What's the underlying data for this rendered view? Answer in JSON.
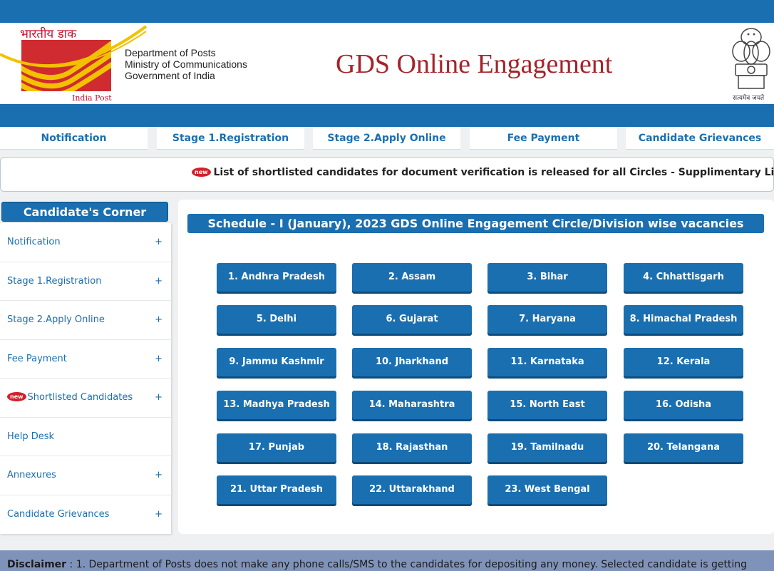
{
  "header": {
    "logo_hindi": "भारतीय डाक",
    "logo_caption": "India Post",
    "dept_lines": [
      "Department of Posts",
      "Ministry of Communications",
      "Government of India"
    ],
    "title": "GDS Online Engagement",
    "emblem_caption": "सत्यमेव जयते"
  },
  "nav": {
    "items": [
      "Notification",
      "Stage 1.Registration",
      "Stage 2.Apply Online",
      "Fee Payment",
      "Candidate Grievances"
    ]
  },
  "marquee": {
    "badge": "new",
    "text": "List of shortlisted candidates for document verification is released for all Circles - Supplimentary List - II"
  },
  "sidebar": {
    "title": "Candidate's Corner",
    "items": [
      {
        "label": "Notification",
        "expand": "+"
      },
      {
        "label": "Stage 1.Registration",
        "expand": "+"
      },
      {
        "label": "Stage 2.Apply Online",
        "expand": "+"
      },
      {
        "label": "Fee Payment",
        "expand": "+"
      },
      {
        "label": "Shortlisted Candidates",
        "expand": "+",
        "badge": "new"
      },
      {
        "label": "Help Desk",
        "expand": ""
      },
      {
        "label": "Annexures",
        "expand": "+"
      },
      {
        "label": "Candidate Grievances",
        "expand": "+"
      }
    ]
  },
  "main": {
    "schedule_title": "Schedule - I (January), 2023 GDS Online Engagement Circle/Division wise vacancies",
    "circles": [
      "1. Andhra Pradesh",
      "2. Assam",
      "3. Bihar",
      "4. Chhattisgarh",
      "5. Delhi",
      "6. Gujarat",
      "7. Haryana",
      "8. Himachal Pradesh",
      "9. Jammu Kashmir",
      "10. Jharkhand",
      "11. Karnataka",
      "12. Kerala",
      "13. Madhya Pradesh",
      "14. Maharashtra",
      "15. North East",
      "16. Odisha",
      "17. Punjab",
      "18. Rajasthan",
      "19. Tamilnadu",
      "20. Telangana",
      "21. Uttar Pradesh",
      "22. Uttarakhand",
      "23. West Bengal"
    ]
  },
  "disclaimer": {
    "label": "Disclaimer",
    "text": ": 1. Department of Posts does not make any phone calls/SMS to the candidates for depositing any money. Selected candidate is getting"
  },
  "colors": {
    "primary_blue": "#1a6fb0",
    "title_red": "#a6232a",
    "logo_red": "#cf2b30",
    "logo_yellow": "#f2c200"
  }
}
